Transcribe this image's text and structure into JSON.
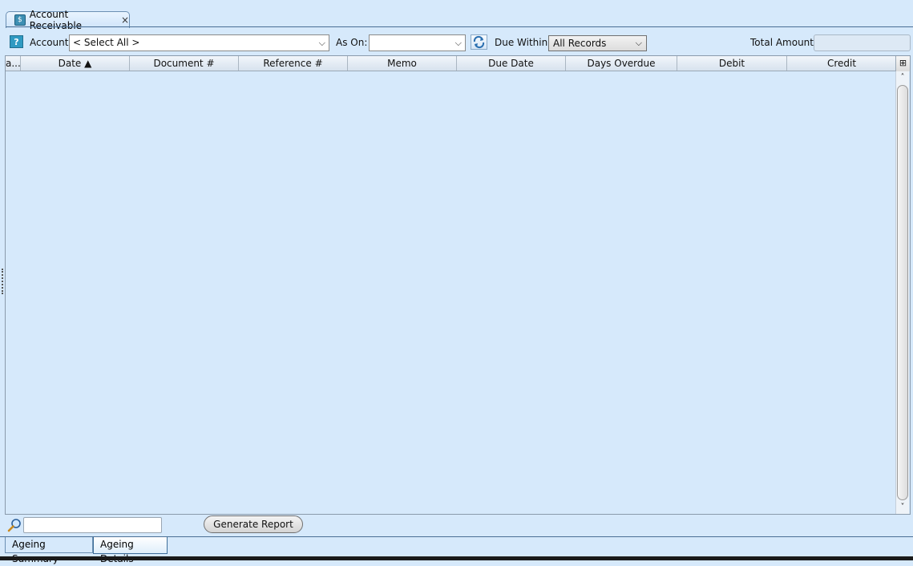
{
  "window": {
    "tab_title": "Account Receivable",
    "tab_close": "×"
  },
  "toolbar": {
    "help": "?",
    "account_label": "Account:",
    "account_value": "< Select All >",
    "as_on_label": "As On:",
    "as_on_value": "",
    "due_within_label": "Due Within:",
    "due_within_value": "All Records",
    "total_amount_label": "Total Amount",
    "total_amount_value": ""
  },
  "grid": {
    "columns": [
      "a...",
      "Date ▲",
      "Document #",
      "Reference  #",
      "Memo",
      "Due Date",
      "Days Overdue",
      "Debit",
      "Credit"
    ],
    "rows": []
  },
  "footer": {
    "search_value": "",
    "generate_label": "Generate Report"
  },
  "bottom_tabs": [
    {
      "label": "Ageing Summary",
      "active": false
    },
    {
      "label": "Ageing Details",
      "active": true
    }
  ]
}
